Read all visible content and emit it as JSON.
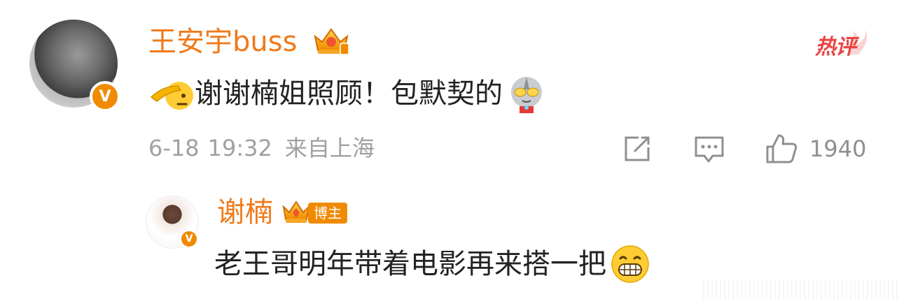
{
  "comment": {
    "username": "王安宇buss",
    "verified_mark": "V",
    "text": "谢谢楠姐照顾！包默契的",
    "lead_emoji": "salute-emoji",
    "tail_emoji": "ultraman-emoji",
    "meta": {
      "date": "6-18",
      "time": "19:32",
      "location": "来自上海"
    },
    "like_count": "1940",
    "hot_label": "热评"
  },
  "reply": {
    "username": "谢楠",
    "verified_mark": "V",
    "role_tag": "博主",
    "text": "老王哥明年带着电影再来搭一把",
    "tail_emoji": "grin-emoji"
  },
  "icons": {
    "share": "share-icon",
    "comment": "comment-icon",
    "like": "thumbs-up-icon"
  },
  "colors": {
    "username": "#f07a1a",
    "verified_badge": "#f08a00",
    "hot_label": "#e94543",
    "meta_text": "#a0a0a0",
    "icon_gray": "#8f8f8f"
  }
}
